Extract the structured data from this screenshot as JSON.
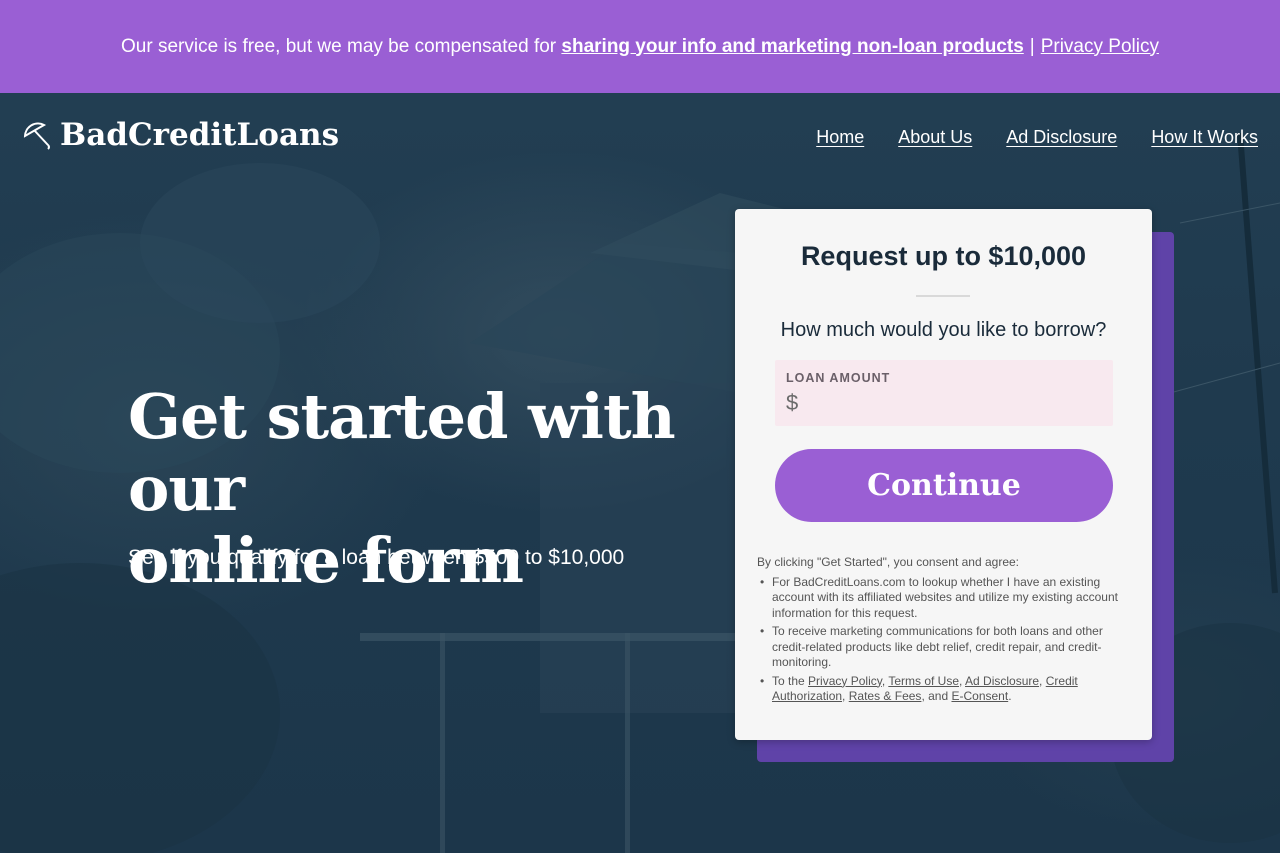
{
  "banner": {
    "text": "Our service is free, but we may be compensated for",
    "bold_link": "sharing your info and marketing non-loan products",
    "separator": "|",
    "policy_link": "Privacy Policy"
  },
  "header": {
    "logo_text": "BadCreditLoans",
    "logo_icon": "umbrella-icon",
    "nav": [
      {
        "label": "Home"
      },
      {
        "label": "About Us"
      },
      {
        "label": "Ad Disclosure"
      },
      {
        "label": "How It Works"
      }
    ]
  },
  "hero": {
    "headline_line1": "Get started with our",
    "headline_line2": "online form",
    "subhead": "See if you qualify for a loan between $500 to $10,000"
  },
  "form": {
    "title": "Request up to $10,000",
    "question": "How much would you like to borrow?",
    "amount_label": "LOAN AMOUNT",
    "currency_symbol": "$",
    "amount_value": "",
    "continue_label": "Continue"
  },
  "consent": {
    "intro": "By clicking \"Get Started\", you consent and agree:",
    "item1": "For BadCreditLoans.com to lookup whether I have an existing account with its affiliated websites and utilize my existing account information for this request.",
    "item2": "To receive marketing communications for both loans and other credit-related products like debt relief, credit repair, and credit-monitoring.",
    "item3_prefix": "To the",
    "links": {
      "privacy": "Privacy Policy",
      "terms": "Terms of Use",
      "ad": "Ad Disclosure",
      "credit": "Credit Authorization",
      "rates": "Rates & Fees",
      "econsent": "E-Consent"
    },
    "sep_comma": ",",
    "and_text": ", and",
    "end_period": "."
  },
  "colors": {
    "brand_purple": "#9a5fd4",
    "card_shadow_purple": "#5f43a8",
    "hero_overlay": "#1f3a4d",
    "input_bg": "#f8e9ef"
  }
}
